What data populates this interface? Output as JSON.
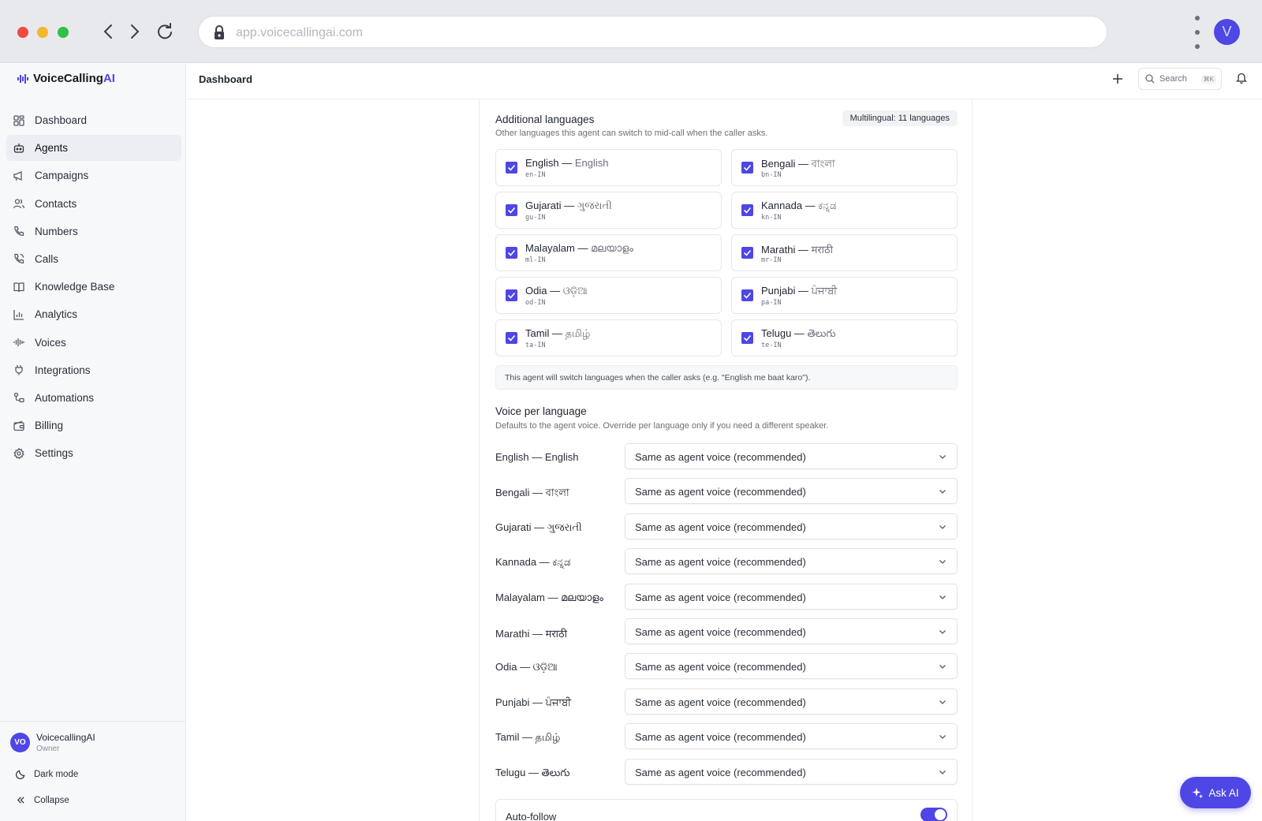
{
  "browser": {
    "url": "app.voicecallingai.com",
    "avatar_letter": "V"
  },
  "brand": {
    "name_prefix": "VoiceCalling",
    "name_suffix": "AI"
  },
  "sidebar": {
    "items": [
      {
        "label": "Dashboard",
        "icon": "grid-icon"
      },
      {
        "label": "Agents",
        "icon": "bot-icon",
        "active": true
      },
      {
        "label": "Campaigns",
        "icon": "megaphone-icon"
      },
      {
        "label": "Contacts",
        "icon": "users-icon"
      },
      {
        "label": "Numbers",
        "icon": "phone-icon"
      },
      {
        "label": "Calls",
        "icon": "phone-call-icon"
      },
      {
        "label": "Knowledge Base",
        "icon": "book-icon"
      },
      {
        "label": "Analytics",
        "icon": "bar-chart-icon"
      },
      {
        "label": "Voices",
        "icon": "waveform-icon"
      },
      {
        "label": "Integrations",
        "icon": "plug-icon"
      },
      {
        "label": "Automations",
        "icon": "workflow-icon"
      },
      {
        "label": "Billing",
        "icon": "wallet-icon"
      },
      {
        "label": "Settings",
        "icon": "gear-icon"
      }
    ],
    "user": {
      "initials": "VO",
      "name": "VoicecallingAI",
      "role": "Owner"
    },
    "dark_mode_label": "Dark mode",
    "collapse_label": "Collapse"
  },
  "topbar": {
    "title": "Dashboard",
    "search_label": "Search",
    "shortcut": "⌘K"
  },
  "additional_languages": {
    "title": "Additional languages",
    "subtitle": "Other languages this agent can switch to mid-call when the caller asks.",
    "badge": "Multilingual: 11 languages",
    "languages": [
      {
        "name": "English",
        "native": "English",
        "code": "en-IN",
        "checked": true
      },
      {
        "name": "Bengali",
        "native": "বাংলা",
        "code": "bn-IN",
        "checked": true
      },
      {
        "name": "Gujarati",
        "native": "ગુજરાતી",
        "code": "gu-IN",
        "checked": true
      },
      {
        "name": "Kannada",
        "native": "ಕನ್ನಡ",
        "code": "kn-IN",
        "checked": true
      },
      {
        "name": "Malayalam",
        "native": "മലയാളം",
        "code": "ml-IN",
        "checked": true
      },
      {
        "name": "Marathi",
        "native": "मराठी",
        "code": "mr-IN",
        "checked": true
      },
      {
        "name": "Odia",
        "native": "ଓଡ଼ିଆ",
        "code": "od-IN",
        "checked": true
      },
      {
        "name": "Punjabi",
        "native": "ਪੰਜਾਬੀ",
        "code": "pa-IN",
        "checked": true
      },
      {
        "name": "Tamil",
        "native": "தமிழ்",
        "code": "ta-IN",
        "checked": true
      },
      {
        "name": "Telugu",
        "native": "తెలుగు",
        "code": "te-IN",
        "checked": true
      }
    ],
    "note": "This agent will switch languages when the caller asks (e.g. \"English me baat karo\")."
  },
  "voice_per_language": {
    "title": "Voice per language",
    "subtitle": "Defaults to the agent voice. Override per language only if you need a different speaker.",
    "rows": [
      {
        "label": "English — English",
        "value": "Same as agent voice (recommended)"
      },
      {
        "label": "Bengali — বাংলা",
        "value": "Same as agent voice (recommended)"
      },
      {
        "label": "Gujarati — ગુજરાતી",
        "value": "Same as agent voice (recommended)"
      },
      {
        "label": "Kannada — ಕನ್ನಡ",
        "value": "Same as agent voice (recommended)"
      },
      {
        "label": "Malayalam — മലയാളം",
        "value": "Same as agent voice (recommended)"
      },
      {
        "label": "Marathi — मराठी",
        "value": "Same as agent voice (recommended)"
      },
      {
        "label": "Odia — ଓଡ଼ିଆ",
        "value": "Same as agent voice (recommended)"
      },
      {
        "label": "Punjabi — ਪੰਜਾਬੀ",
        "value": "Same as agent voice (recommended)"
      },
      {
        "label": "Tamil — தமிழ்",
        "value": "Same as agent voice (recommended)"
      },
      {
        "label": "Telugu — తెలుగు",
        "value": "Same as agent voice (recommended)"
      }
    ]
  },
  "auto_follow": {
    "label": "Auto-follow",
    "enabled": true
  },
  "ask_ai_label": "Ask AI",
  "colors": {
    "accent": "#4e46e5",
    "sidebar_bg": "#f7f8fa"
  }
}
